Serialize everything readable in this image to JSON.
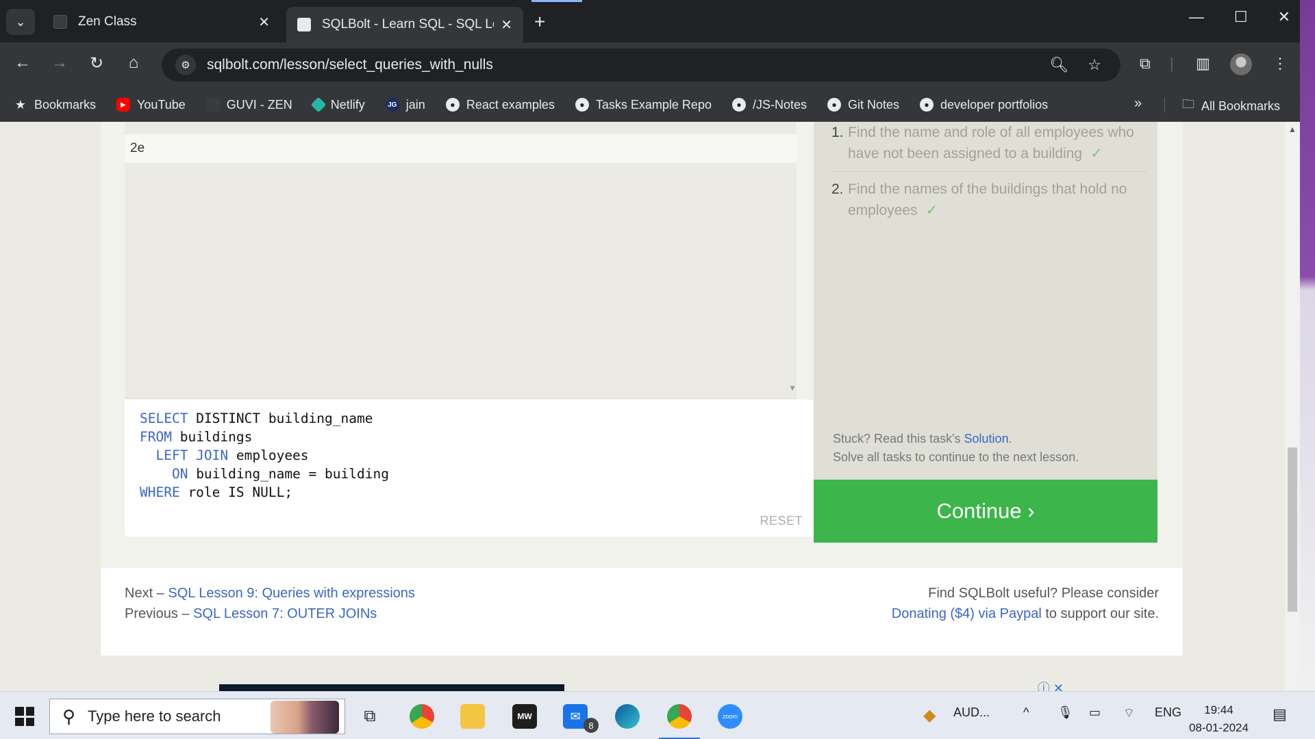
{
  "browser": {
    "tabs": [
      {
        "title": "Zen Class",
        "active": false
      },
      {
        "title": "SQLBolt - Learn SQL - SQL Less",
        "active": true
      }
    ],
    "url": "sqlbolt.com/lesson/select_queries_with_nulls",
    "bookmarks": [
      {
        "label": "Bookmarks",
        "icon": "star-icon"
      },
      {
        "label": "YouTube",
        "icon": "youtube-icon"
      },
      {
        "label": "GUVI - ZEN",
        "icon": "guvi-icon"
      },
      {
        "label": "Netlify",
        "icon": "netlify-icon"
      },
      {
        "label": "jain",
        "icon": "jain-icon"
      },
      {
        "label": "React examples",
        "icon": "github-icon"
      },
      {
        "label": "Tasks Example Repo",
        "icon": "github-icon"
      },
      {
        "label": "/JS-Notes",
        "icon": "github-icon"
      },
      {
        "label": "Git Notes",
        "icon": "github-icon"
      },
      {
        "label": "developer portfolios",
        "icon": "github-icon"
      }
    ],
    "all_bookmarks": "All Bookmarks"
  },
  "lesson": {
    "result_row": "2e",
    "query_lines": [
      {
        "kw": "SELECT",
        "rest": " DISTINCT building_name"
      },
      {
        "kw": "FROM",
        "rest": " buildings"
      },
      {
        "kw": "  LEFT JOIN",
        "rest": " employees"
      },
      {
        "kw": "    ON",
        "rest": " building_name = building"
      },
      {
        "kw": "WHERE",
        "rest": " role IS NULL;"
      }
    ],
    "reset_label": "RESET",
    "tasks": [
      {
        "num": "1.",
        "text": "Find the name and role of all employees who have not been assigned to a building",
        "check": "✓"
      },
      {
        "num": "2.",
        "text": "Find the names of the buildings that hold no employees",
        "check": "✓"
      }
    ],
    "stuck_prefix": "Stuck? Read this task's ",
    "solution_link": "Solution",
    "stuck_suffix": ".",
    "solve_all": "Solve all tasks to continue to the next lesson.",
    "continue_label": "Continue ›"
  },
  "footer": {
    "next_prefix": "Next – ",
    "next_link": "SQL Lesson 9: Queries with expressions",
    "prev_prefix": "Previous – ",
    "prev_link": "SQL Lesson 7: OUTER JOINs",
    "useful": "Find SQLBolt useful? Please consider",
    "donate_link": "Donating ($4) via Paypal",
    "donate_suffix": " to support our site."
  },
  "taskbar": {
    "search_placeholder": "Type here to search",
    "mail_badge": "8",
    "audio_label": "AUD...",
    "lang": "ENG",
    "time": "19:44",
    "date": "08-01-2024"
  },
  "colors": {
    "accent": "#3cb54a",
    "link": "#3a66c4"
  }
}
